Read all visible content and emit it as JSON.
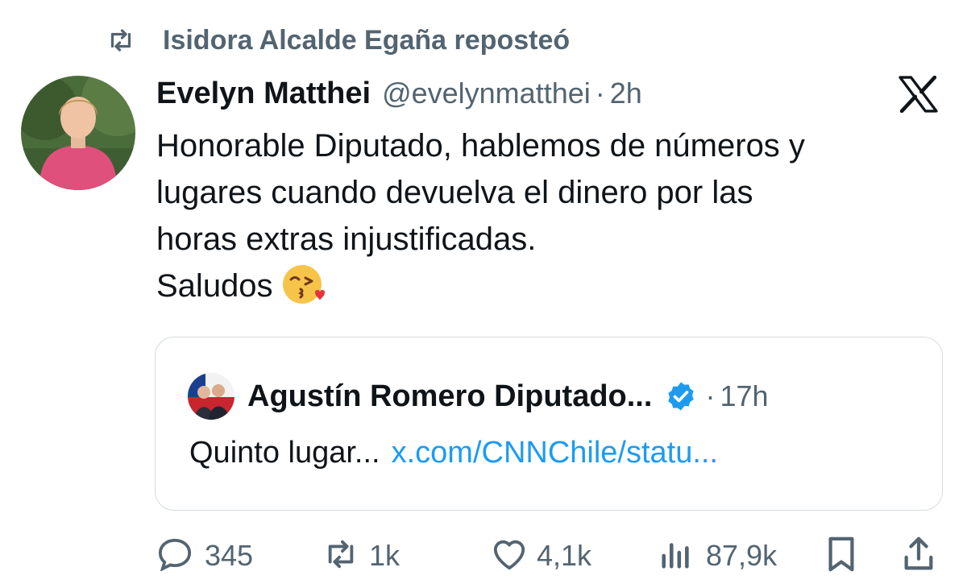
{
  "repost": {
    "label": "Isidora Alcalde Egaña reposteó",
    "icon": "repost-icon"
  },
  "tweet": {
    "author_name": "Evelyn Matthei",
    "handle": "@evelynmatthei",
    "separator": "·",
    "time": "2h",
    "lines": [
      "Honorable Diputado, hablemos de números y",
      "lugares cuando devuelva el dinero por las",
      "horas extras injustificadas.",
      "Saludos"
    ],
    "emoji": "face-blowing-kiss-icon"
  },
  "quoted": {
    "author_name": "Agustín Romero Diputado...",
    "separator": "·",
    "time": "17h",
    "verified": "verified-badge-icon",
    "text": "Quinto lugar...",
    "link": "x.com/CNNChile/statu..."
  },
  "actions": {
    "replies": "345",
    "reposts": "1k",
    "likes": "4,1k",
    "views": "87,9k"
  },
  "colors": {
    "text": "#0f1419",
    "muted": "#536471",
    "link": "#1d9bf0",
    "border": "#d6dbdf"
  }
}
